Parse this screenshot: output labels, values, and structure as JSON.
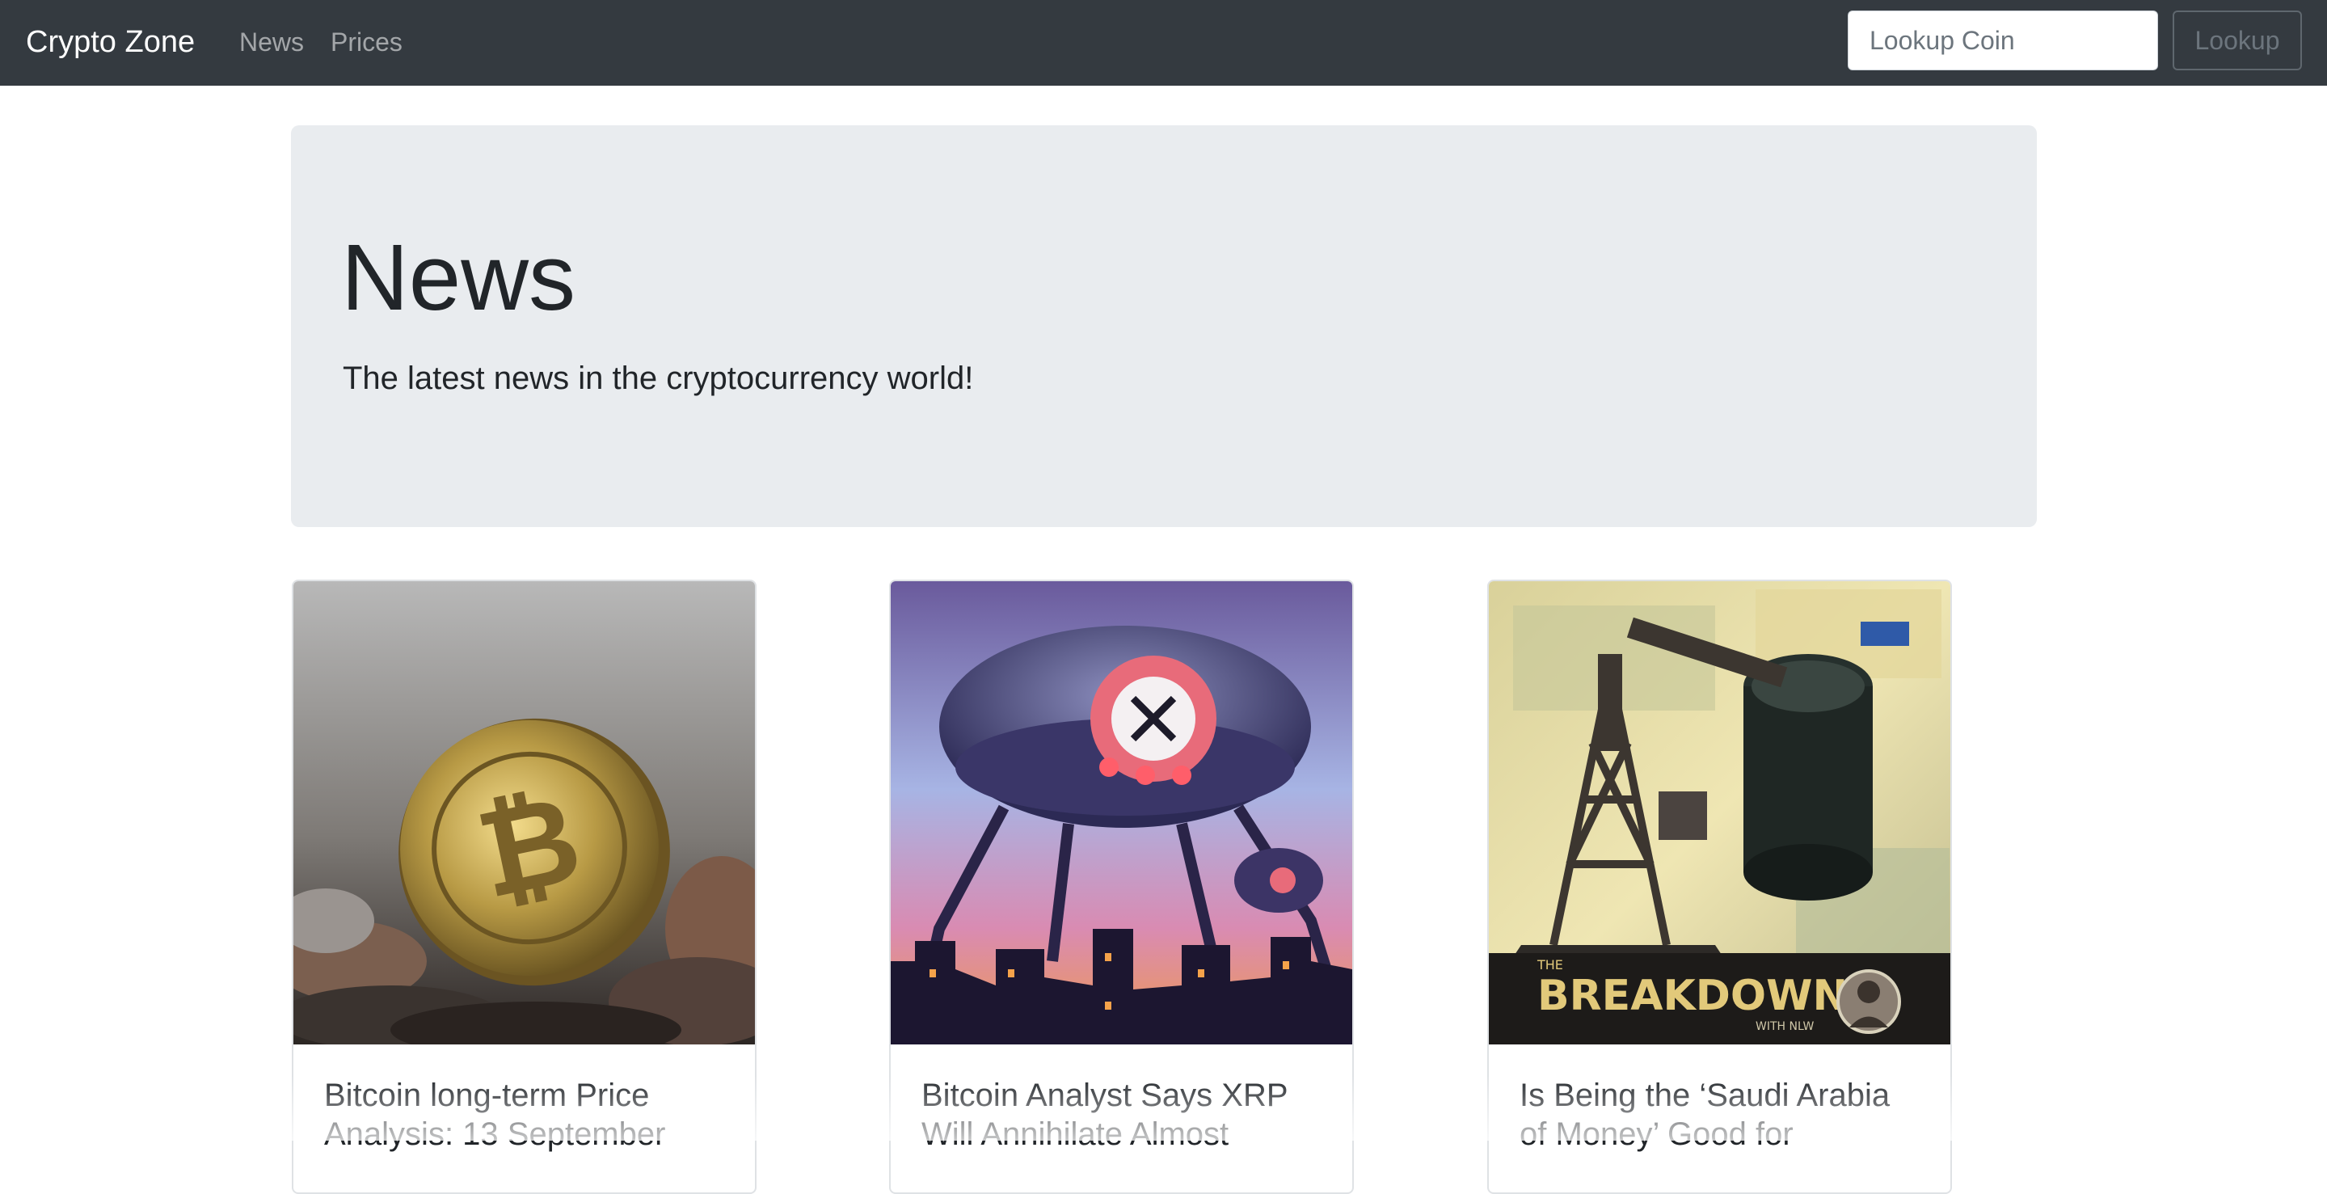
{
  "navbar": {
    "brand": "Crypto Zone",
    "links": [
      {
        "label": "News"
      },
      {
        "label": "Prices"
      }
    ],
    "search": {
      "placeholder": "Lookup Coin",
      "value": "",
      "button_label": "Lookup"
    }
  },
  "jumbotron": {
    "title": "News",
    "lead": "The latest news in the cryptocurrency world!"
  },
  "cards": [
    {
      "title": "Bitcoin long-term Price Analysis: 13 September",
      "image": "bitcoin-coin-image"
    },
    {
      "title": "Bitcoin Analyst Says XRP Will Annihilate Almost",
      "image": "xrp-robot-image"
    },
    {
      "title": "Is Being the ‘Saudi Arabia of Money’ Good for",
      "image": "oil-derrick-money-image",
      "image_text": "THE BREAKDOWN WITH NLW"
    }
  ],
  "colors": {
    "navbar_bg": "#343a40",
    "jumbotron_bg": "#e9ecef",
    "text": "#212529"
  }
}
